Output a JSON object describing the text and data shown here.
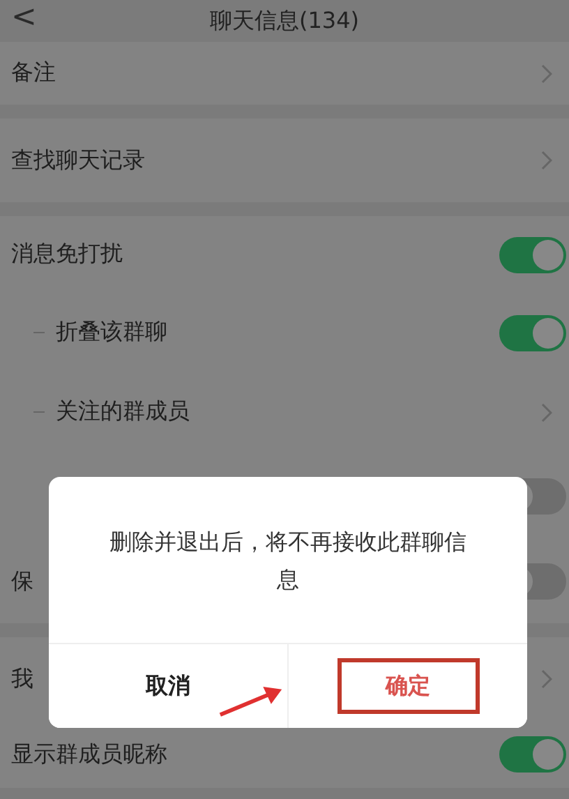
{
  "header": {
    "back": "<",
    "title": "聊天信息(134)"
  },
  "sections": [
    {
      "rows": [
        {
          "kind": "link",
          "label": "备注"
        }
      ]
    },
    {
      "rows": [
        {
          "kind": "link",
          "label": "查找聊天记录"
        }
      ]
    },
    {
      "rows": [
        {
          "kind": "toggle",
          "label": "消息免打扰",
          "on": true,
          "children": [
            {
              "kind": "toggle",
              "label": "折叠该群聊",
              "on": true
            },
            {
              "kind": "link",
              "label": "关注的群成员"
            }
          ]
        },
        {
          "kind": "toggle",
          "on": false
        },
        {
          "kind": "toggle",
          "label": "保",
          "on": false
        }
      ]
    },
    {
      "rows": [
        {
          "kind": "link",
          "label": "我"
        },
        {
          "kind": "toggle",
          "label": "显示群成员昵称",
          "on": true
        }
      ]
    }
  ],
  "dialog": {
    "message": "删除并退出后，将不再接收此群聊信息",
    "buttons": [
      {
        "label": "取消",
        "kind": "cancel",
        "highlighted": false
      },
      {
        "label": "确定",
        "kind": "confirm",
        "highlighted": true
      }
    ]
  }
}
